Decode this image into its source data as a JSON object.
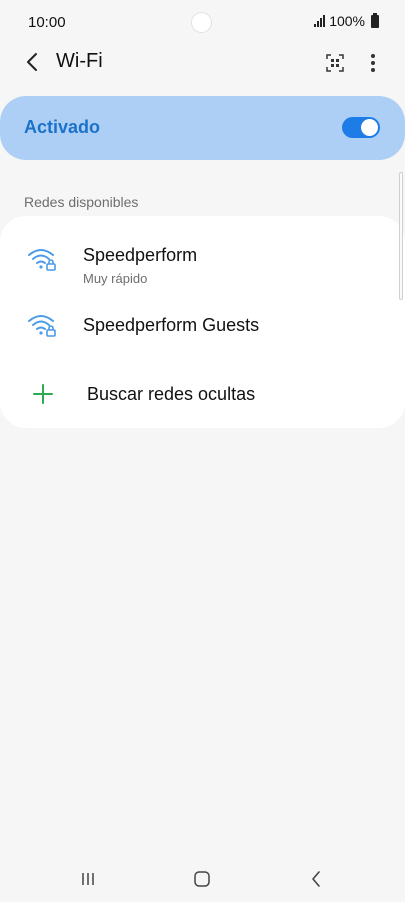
{
  "status_bar": {
    "time": "10:00",
    "battery": "100%"
  },
  "header": {
    "title": "Wi-Fi",
    "back_icon": "chevron-left-icon",
    "qr_icon": "qr-code-icon",
    "more_icon": "more-vertical-icon"
  },
  "master_toggle": {
    "label": "Activado",
    "state": "on",
    "accent_color": "#1e7ce6",
    "card_color": "#aecff5"
  },
  "networks_section": {
    "label": "Redes disponibles",
    "networks": [
      {
        "name": "Speedperform",
        "subtitle": "Muy rápido",
        "icon": "wifi-locked-icon"
      },
      {
        "name": "Speedperform Guests",
        "subtitle": "",
        "icon": "wifi-locked-icon"
      }
    ],
    "add_hidden": {
      "label": "Buscar redes ocultas",
      "icon": "plus-icon",
      "icon_color": "#2eaa4f"
    }
  },
  "nav_bar": {
    "recents_icon": "recents-icon",
    "home_icon": "home-icon",
    "back_icon": "back-icon"
  }
}
